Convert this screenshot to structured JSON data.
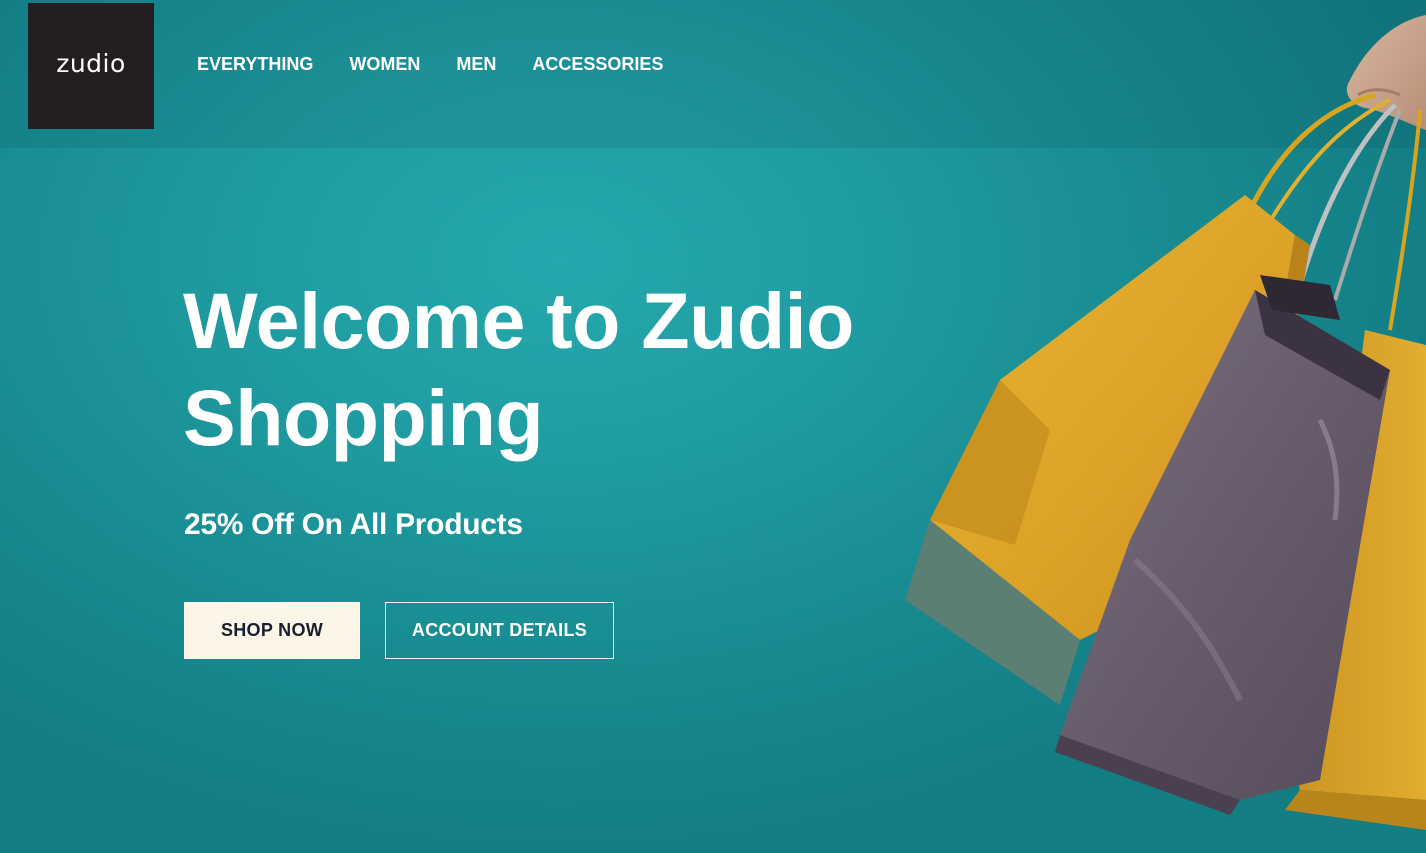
{
  "brand": {
    "logo_text": "zudio",
    "logo_bg": "#231f20"
  },
  "nav": {
    "items": [
      {
        "label": "EVERYTHING"
      },
      {
        "label": "WOMEN"
      },
      {
        "label": "MEN"
      },
      {
        "label": "ACCESSORIES"
      }
    ]
  },
  "hero": {
    "title_line1": "Welcome to Zudio",
    "title_line2": "Shopping",
    "subtitle": "25% Off On All Products",
    "primary_button": "SHOP NOW",
    "secondary_button": "ACCOUNT DETAILS",
    "image_name": "shopping-bags-image"
  },
  "colors": {
    "background": "#1f9ca1",
    "primary_button_bg": "#fcf5e8",
    "primary_button_text": "#1a1f2e",
    "bag_yellow": "#e2aa2a",
    "bag_gray": "#6b6170"
  }
}
